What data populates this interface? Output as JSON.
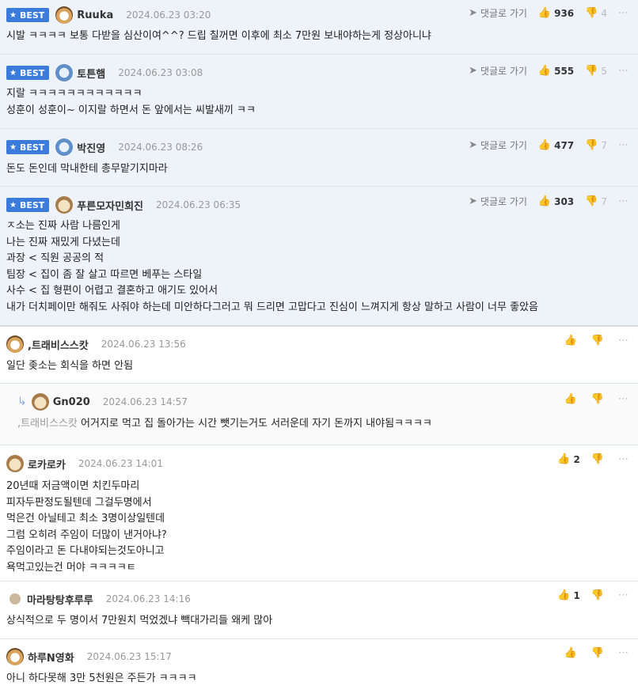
{
  "ui": {
    "best_label": "BEST",
    "reply_goto_label": "댓글로 가기"
  },
  "comments": [
    {
      "nickname": "Ruuka",
      "date": "2024.06.23 03:20",
      "likes": "936",
      "dislikes": "4",
      "lines": [
        "시발 ㅋㅋㅋㅋ 보통 다받을 심산이여^^? 드립 칠꺼면 이후에 최소 7만원 보내야하는게 정상아니냐"
      ]
    },
    {
      "nickname": "토튼햄",
      "date": "2024.06.23 03:08",
      "likes": "555",
      "dislikes": "5",
      "lines": [
        "지랄 ㅋㅋㅋㅋㅋㅋㅋㅋㅋㅋㅋㅋ",
        "성훈이 성훈이~ 이지랄 하면서 돈 앞에서는 씨발새끼 ㅋㅋ"
      ]
    },
    {
      "nickname": "박진영",
      "date": "2024.06.23 08:26",
      "likes": "477",
      "dislikes": "7",
      "lines": [
        "돈도 돈인데 막내한테 총무맡기지마라"
      ]
    },
    {
      "nickname": "푸른모자민희진",
      "date": "2024.06.23 06:35",
      "likes": "303",
      "dislikes": "7",
      "lines": [
        "ㅈ소는 진짜 사람 나름인게",
        "나는 진짜 재밌게 다녔는데",
        "과장 < 직원 공공의 적",
        "팀장 < 집이 좀 잘 살고 따르면 베푸는 스타일",
        "사수 < 집 형편이 어렵고 결혼하고 애기도 있어서",
        "내가 더치페이만 해줘도 사줘야 하는데 미안하다그러고 뭐 드리면 고맙다고 진심이 느껴지게 항상 말하고 사람이 너무 좋았음"
      ]
    },
    {
      "nickname": ",트래비스스캇",
      "date": "2024.06.23 13:56",
      "likes": "",
      "lines": [
        "일단 좆소는 회식을 하면 안됨"
      ]
    },
    {
      "nickname": "Gn020",
      "date": "2024.06.23 14:57",
      "likes": "",
      "mention": ",트래비스스캇",
      "lines": [
        "어거지로 먹고 집 돌아가는 시간 뺏기는거도 서러운데 자기 돈까지 내야됨ㅋㅋㅋㅋ"
      ]
    },
    {
      "nickname": "로카로카",
      "date": "2024.06.23 14:01",
      "likes": "2",
      "lines": [
        "20년때 저금액이면 치킨두마리",
        "피자두판정도될텐데 그걸두명에서",
        "먹은건 아닐테고 최소 3명이상일텐데",
        "그럼 오히려 주임이 더많이 낸거아냐?",
        "주임이라고 돈 다내야되는것도아니고",
        "욕먹고있는건 머야 ㅋㅋㅋㅋㅌ"
      ]
    },
    {
      "nickname": "마라탕탕후루루",
      "date": "2024.06.23 14:16",
      "likes": "1",
      "lines": [
        "상식적으로 두 명이서 7만원치 먹었겠냐 빽대가리들 왜케 많아"
      ]
    },
    {
      "nickname": "하루N영화",
      "date": "2024.06.23 15:17",
      "likes": "",
      "lines": [
        "아니 하다못해 3만 5천원은 주든가 ㅋㅋㅋㅋ"
      ]
    }
  ]
}
